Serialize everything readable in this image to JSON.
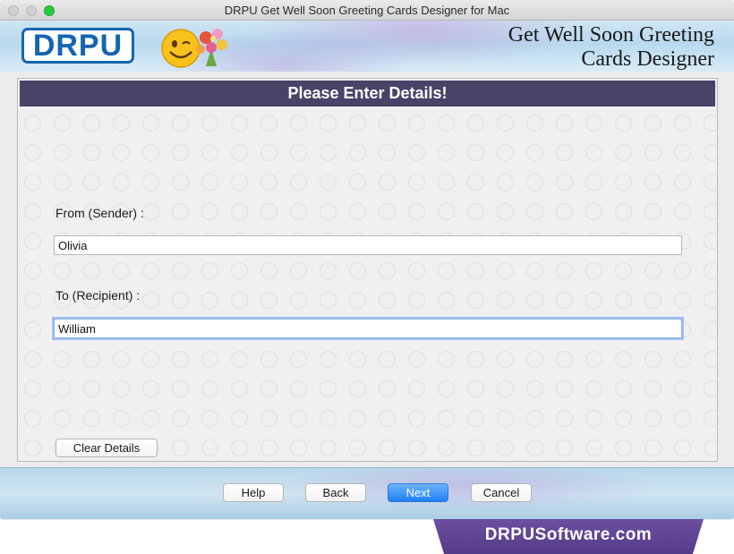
{
  "window": {
    "title": "DRPU Get Well Soon Greeting Cards Designer for Mac"
  },
  "header": {
    "logo_text": "DRPU",
    "title_line1": "Get Well Soon Greeting",
    "title_line2": "Cards Designer"
  },
  "panel": {
    "heading": "Please Enter Details!",
    "sender_label": "From (Sender) :",
    "sender_value": "Olivia",
    "recipient_label": "To (Recipient) :",
    "recipient_value": "William",
    "clear_label": "Clear Details"
  },
  "footer": {
    "help_label": "Help",
    "back_label": "Back",
    "next_label": "Next",
    "cancel_label": "Cancel"
  },
  "banner": {
    "text": "DRPUSoftware.com"
  },
  "colors": {
    "panel_header": "#4b4268",
    "logo_blue": "#1565b0",
    "primary_button": "#1f7ff5",
    "banner": "#5e439a"
  }
}
